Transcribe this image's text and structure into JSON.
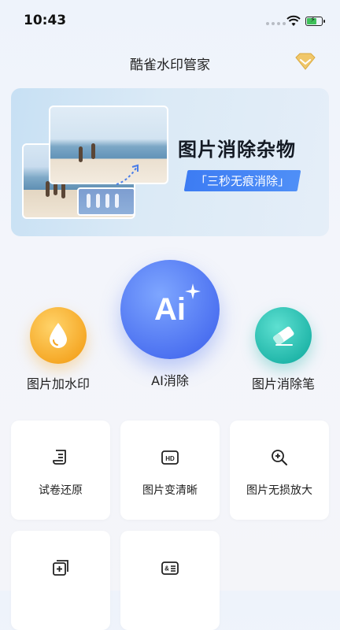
{
  "status_bar": {
    "time": "10:43"
  },
  "header": {
    "title": "酷雀水印管家",
    "vip_icon": "diamond-icon"
  },
  "banner": {
    "title": "图片消除杂物",
    "tag": "「三秒无痕消除」"
  },
  "features": [
    {
      "label": "图片加水印",
      "icon": "drop-icon",
      "color": "#f5a623"
    },
    {
      "label": "AI消除",
      "icon": "ai-sparkle-icon",
      "color": "#4a6ff0",
      "icon_text": "Ai"
    },
    {
      "label": "图片消除笔",
      "icon": "eraser-icon",
      "color": "#1fb5a8"
    }
  ],
  "tools": [
    {
      "label": "试卷还原",
      "icon": "paper-scroll-icon"
    },
    {
      "label": "图片变清晰",
      "icon": "hd-icon",
      "icon_text": "HD"
    },
    {
      "label": "图片无损放大",
      "icon": "zoom-in-icon"
    },
    {
      "label": "",
      "icon": "add-layer-icon"
    },
    {
      "label": "",
      "icon": "id-card-icon"
    }
  ]
}
